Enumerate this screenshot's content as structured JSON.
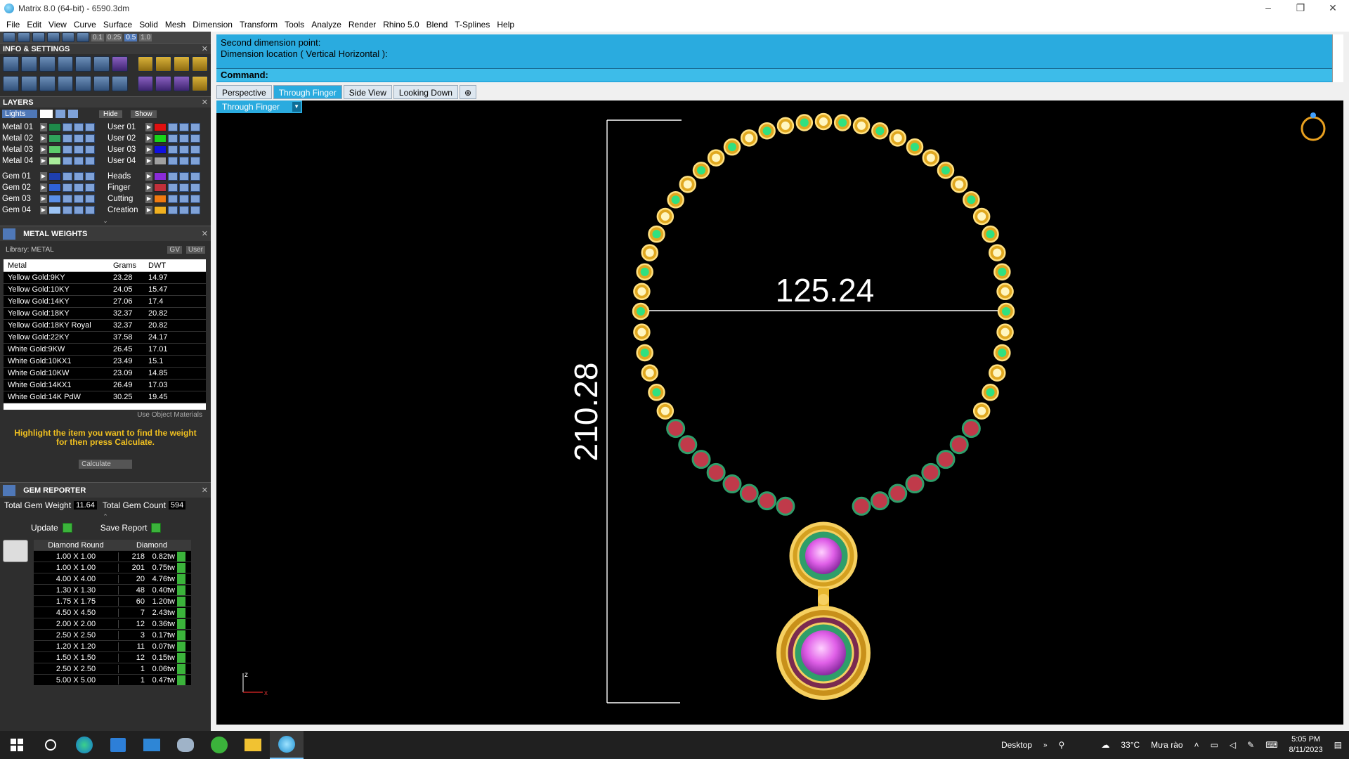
{
  "window": {
    "title": "Matrix 8.0 (64-bit) - 6590.3dm"
  },
  "menu": [
    "File",
    "Edit",
    "View",
    "Curve",
    "Surface",
    "Solid",
    "Mesh",
    "Dimension",
    "Transform",
    "Tools",
    "Analyze",
    "Render",
    "Rhino 5.0",
    "Blend",
    "T-Splines",
    "Help"
  ],
  "top_toolbar": {
    "values": [
      "0.1",
      "0.25",
      "0.5",
      "1.0"
    ]
  },
  "info_settings": {
    "title": "INFO & SETTINGS"
  },
  "layers": {
    "title": "LAYERS",
    "lights_label": "Lights",
    "hide_label": "Hide",
    "show_label": "Show",
    "left": [
      {
        "name": "Metal 01",
        "color": "#1e8a4a"
      },
      {
        "name": "Metal 02",
        "color": "#2fa35a"
      },
      {
        "name": "Metal 03",
        "color": "#5ccd6b"
      },
      {
        "name": "Metal 04",
        "color": "#a8ec9a"
      },
      {
        "name": "Gem 01",
        "color": "#1e3fae"
      },
      {
        "name": "Gem 02",
        "color": "#2f62d8"
      },
      {
        "name": "Gem 03",
        "color": "#5a8fe8"
      },
      {
        "name": "Gem 04",
        "color": "#9cc3f4"
      }
    ],
    "right": [
      {
        "name": "User 01",
        "color": "#e01010"
      },
      {
        "name": "User 02",
        "color": "#18d418"
      },
      {
        "name": "User 03",
        "color": "#1010e0"
      },
      {
        "name": "User 04",
        "color": "#a0a0a0"
      },
      {
        "name": "Heads",
        "color": "#8a2bd8"
      },
      {
        "name": "Finger",
        "color": "#c0303a"
      },
      {
        "name": "Cutting",
        "color": "#f07a10"
      },
      {
        "name": "Creation",
        "color": "#f0b020"
      }
    ]
  },
  "metal_weights": {
    "title": "METAL WEIGHTS",
    "library": "Library: METAL",
    "gv_label": "GV",
    "user_label": "User",
    "columns": [
      "Metal",
      "Grams",
      "DWT"
    ],
    "rows": [
      [
        "Yellow Gold:9KY",
        "23.28",
        "14.97"
      ],
      [
        "Yellow Gold:10KY",
        "24.05",
        "15.47"
      ],
      [
        "Yellow Gold:14KY",
        "27.06",
        "17.4"
      ],
      [
        "Yellow Gold:18KY",
        "32.37",
        "20.82"
      ],
      [
        "Yellow Gold:18KY Royal",
        "32.37",
        "20.82"
      ],
      [
        "Yellow Gold:22KY",
        "37.58",
        "24.17"
      ],
      [
        "White Gold:9KW",
        "26.45",
        "17.01"
      ],
      [
        "White Gold:10KX1",
        "23.49",
        "15.1"
      ],
      [
        "White Gold:10KW",
        "23.09",
        "14.85"
      ],
      [
        "White Gold:14KX1",
        "26.49",
        "17.03"
      ],
      [
        "White Gold:14K PdW",
        "30.25",
        "19.45"
      ]
    ],
    "use_object_materials": "Use Object Materials",
    "hint": "Highlight the item you want to find the weight for then press Calculate.",
    "calculate": "Calculate"
  },
  "gem_reporter": {
    "title": "GEM REPORTER",
    "total_weight_label": "Total Gem Weight",
    "total_weight": "11.64",
    "total_count_label": "Total Gem Count",
    "total_count": "594",
    "update": "Update",
    "save_report": "Save Report",
    "col1": "Diamond Round",
    "col2": "Diamond",
    "rows": [
      [
        "1.00 X 1.00",
        "218",
        "0.82tw"
      ],
      [
        "1.00 X 1.00",
        "201",
        "0.75tw"
      ],
      [
        "4.00 X 4.00",
        "20",
        "4.76tw"
      ],
      [
        "1.30 X 1.30",
        "48",
        "0.40tw"
      ],
      [
        "1.75 X 1.75",
        "60",
        "1.20tw"
      ],
      [
        "4.50 X 4.50",
        "7",
        "2.43tw"
      ],
      [
        "2.00 X 2.00",
        "12",
        "0.36tw"
      ],
      [
        "2.50 X 2.50",
        "3",
        "0.17tw"
      ],
      [
        "1.20 X 1.20",
        "11",
        "0.07tw"
      ],
      [
        "1.50 X 1.50",
        "12",
        "0.15tw"
      ],
      [
        "2.50 X 2.50",
        "1",
        "0.06tw"
      ],
      [
        "5.00 X 5.00",
        "1",
        "0.47tw"
      ]
    ]
  },
  "command": {
    "line1": "Second dimension point:",
    "line2": "Dimension location ( Vertical  Horizontal ):",
    "label": "Command:"
  },
  "tabs": [
    "Perspective",
    "Through Finger",
    "Side View",
    "Looking Down"
  ],
  "active_tab": "Through Finger",
  "viewport": {
    "label": "Through Finger",
    "dim_horizontal": "125.24",
    "dim_vertical": "210.28",
    "axis_x": "x",
    "axis_z": "z"
  },
  "taskbar": {
    "desktop": "Desktop",
    "weather": "33°C",
    "weather_text": "Mưa rào",
    "time": "5:05 PM",
    "date": "8/11/2023"
  }
}
